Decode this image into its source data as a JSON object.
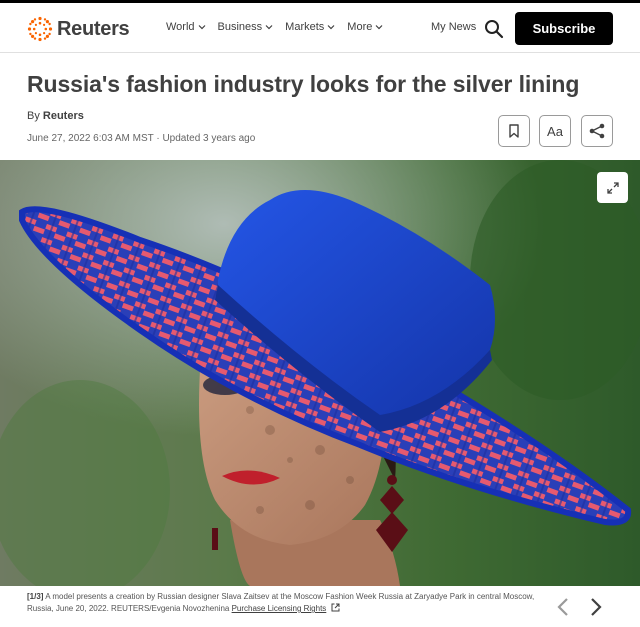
{
  "header": {
    "logo_text": "Reuters",
    "nav": [
      {
        "label": "World"
      },
      {
        "label": "Business"
      },
      {
        "label": "Markets"
      },
      {
        "label": "More"
      }
    ],
    "my_news": "My News",
    "search_icon": "search-icon",
    "subscribe_label": "Subscribe"
  },
  "article": {
    "headline": "Russia's fashion industry looks for the silver lining",
    "byline_prefix": "By",
    "author": "Reuters",
    "dateline": "June 27, 2022 6:03 AM MST · Updated 3 years ago",
    "tools": {
      "bookmark_icon": "bookmark-icon",
      "text_size_label": "Aa",
      "share_icon": "share-icon"
    }
  },
  "gallery": {
    "expand_icon": "expand-icon",
    "index": "[1/3]",
    "caption": "A model presents a creation by Russian designer Slava Zaitsev at the Moscow Fashion Week Russia at Zaryadye Park in central Moscow, Russia, June 20, 2022. REUTERS/Evgenia Novozhenina",
    "license_link": "Purchase Licensing Rights",
    "prev_icon": "chevron-left-icon",
    "next_icon": "chevron-right-icon"
  },
  "colors": {
    "brand_orange": "#fa6400",
    "text": "#404040",
    "subscribe_bg": "#000000",
    "hat_blue": "#1a3fc8",
    "hat_red": "#e8506a"
  }
}
